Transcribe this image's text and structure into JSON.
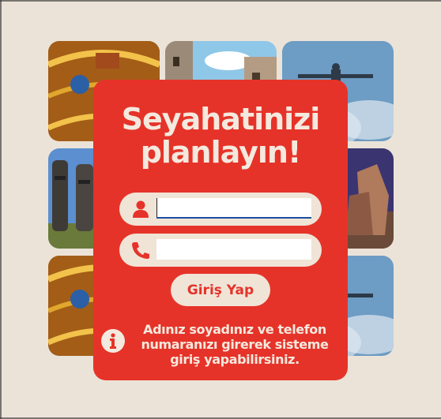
{
  "login_card": {
    "title_line1": "Seyahatinizi",
    "title_line2": "planlayın!",
    "name_input": {
      "value": "",
      "placeholder": ""
    },
    "phone_input": {
      "value": "",
      "placeholder": ""
    },
    "submit_label": "Giriş Yap",
    "info_text": "Adınız soyadınız ve telefon numaranızı girerek sisteme giriş yapabilirsiniz."
  },
  "gallery": {
    "tiles": [
      "ceiling-fresco-photo",
      "street-photo",
      "christ-statue-photo",
      "moai-statues-photo",
      "stone-heads-photo",
      "ceiling-fresco-photo",
      "christ-statue-photo"
    ]
  },
  "colors": {
    "background": "#ece3d8",
    "card": "#e63329",
    "card_text": "#f4e9de",
    "field_bg": "#f0e4d7"
  },
  "icons": {
    "name_field": "user-icon",
    "phone_field": "phone-icon",
    "info": "info-icon"
  }
}
